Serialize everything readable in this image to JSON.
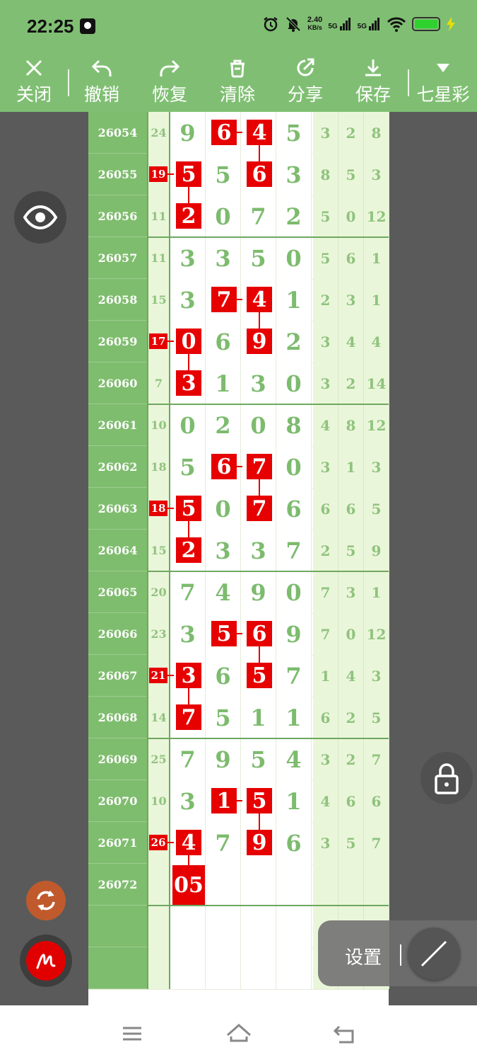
{
  "status_bar": {
    "time": "22:25",
    "speed_value": "2.40",
    "speed_unit": "KB/s",
    "signal1": "5G",
    "signal2": "5G"
  },
  "toolbar": {
    "close": "关闭",
    "undo": "撤销",
    "redo": "恢复",
    "clear": "清除",
    "share": "分享",
    "save": "保存",
    "lottery": "七星彩"
  },
  "chart_data": {
    "type": "table",
    "columns": [
      "issue",
      "sum",
      "d1",
      "d2",
      "d3",
      "d4",
      "s1",
      "s2",
      "s3"
    ],
    "rows": [
      {
        "issue": "26054",
        "sum": "24",
        "digits": [
          "9",
          "6",
          "4",
          "5"
        ],
        "side": [
          "3",
          "2",
          "8"
        ]
      },
      {
        "issue": "26055",
        "sum": "19",
        "digits": [
          "5",
          "5",
          "6",
          "3"
        ],
        "side": [
          "8",
          "5",
          "3"
        ]
      },
      {
        "issue": "26056",
        "sum": "11",
        "digits": [
          "2",
          "0",
          "7",
          "2"
        ],
        "side": [
          "5",
          "0",
          "12"
        ]
      },
      {
        "issue": "26057",
        "sum": "11",
        "digits": [
          "3",
          "3",
          "5",
          "0"
        ],
        "side": [
          "5",
          "6",
          "1"
        ]
      },
      {
        "issue": "26058",
        "sum": "15",
        "digits": [
          "3",
          "7",
          "4",
          "1"
        ],
        "side": [
          "2",
          "3",
          "1"
        ]
      },
      {
        "issue": "26059",
        "sum": "17",
        "digits": [
          "0",
          "6",
          "9",
          "2"
        ],
        "side": [
          "3",
          "4",
          "4"
        ]
      },
      {
        "issue": "26060",
        "sum": "7",
        "digits": [
          "3",
          "1",
          "3",
          "0"
        ],
        "side": [
          "3",
          "2",
          "14"
        ]
      },
      {
        "issue": "26061",
        "sum": "10",
        "digits": [
          "0",
          "2",
          "0",
          "8"
        ],
        "side": [
          "4",
          "8",
          "12"
        ]
      },
      {
        "issue": "26062",
        "sum": "18",
        "digits": [
          "5",
          "6",
          "7",
          "0"
        ],
        "side": [
          "3",
          "1",
          "3"
        ]
      },
      {
        "issue": "26063",
        "sum": "18",
        "digits": [
          "5",
          "0",
          "7",
          "6"
        ],
        "side": [
          "6",
          "6",
          "5"
        ]
      },
      {
        "issue": "26064",
        "sum": "15",
        "digits": [
          "2",
          "3",
          "3",
          "7"
        ],
        "side": [
          "2",
          "5",
          "9"
        ]
      },
      {
        "issue": "26065",
        "sum": "20",
        "digits": [
          "7",
          "4",
          "9",
          "0"
        ],
        "side": [
          "7",
          "3",
          "1"
        ]
      },
      {
        "issue": "26066",
        "sum": "23",
        "digits": [
          "3",
          "5",
          "6",
          "9"
        ],
        "side": [
          "7",
          "0",
          "12"
        ]
      },
      {
        "issue": "26067",
        "sum": "21",
        "digits": [
          "3",
          "6",
          "5",
          "7"
        ],
        "side": [
          "1",
          "4",
          "3"
        ]
      },
      {
        "issue": "26068",
        "sum": "14",
        "digits": [
          "7",
          "5",
          "1",
          "1"
        ],
        "side": [
          "6",
          "2",
          "5"
        ]
      },
      {
        "issue": "26069",
        "sum": "25",
        "digits": [
          "7",
          "9",
          "5",
          "4"
        ],
        "side": [
          "3",
          "2",
          "7"
        ]
      },
      {
        "issue": "26070",
        "sum": "10",
        "digits": [
          "3",
          "1",
          "5",
          "1"
        ],
        "side": [
          "4",
          "6",
          "6"
        ]
      },
      {
        "issue": "26071",
        "sum": "26",
        "digits": [
          "4",
          "7",
          "9",
          "6"
        ],
        "side": [
          "3",
          "5",
          "7"
        ]
      },
      {
        "issue": "26072",
        "sum": "",
        "digits": [
          "05",
          "",
          "",
          ""
        ],
        "side": [
          "",
          "",
          ""
        ]
      }
    ],
    "highlights": [
      {
        "row": 0,
        "col": 1
      },
      {
        "row": 0,
        "col": 2
      },
      {
        "row": 1,
        "col": 2
      },
      {
        "row": 1,
        "col": 0
      },
      {
        "row": 1,
        "col": "sum"
      },
      {
        "row": 2,
        "col": 0
      },
      {
        "row": 4,
        "col": 1
      },
      {
        "row": 4,
        "col": 2
      },
      {
        "row": 5,
        "col": 2
      },
      {
        "row": 5,
        "col": 0
      },
      {
        "row": 5,
        "col": "sum"
      },
      {
        "row": 6,
        "col": 0
      },
      {
        "row": 8,
        "col": 1
      },
      {
        "row": 8,
        "col": 2
      },
      {
        "row": 9,
        "col": 2
      },
      {
        "row": 9,
        "col": 0
      },
      {
        "row": 9,
        "col": "sum"
      },
      {
        "row": 10,
        "col": 0
      },
      {
        "row": 12,
        "col": 1
      },
      {
        "row": 12,
        "col": 2
      },
      {
        "row": 13,
        "col": 2
      },
      {
        "row": 13,
        "col": 0
      },
      {
        "row": 13,
        "col": "sum"
      },
      {
        "row": 14,
        "col": 0
      },
      {
        "row": 16,
        "col": 1
      },
      {
        "row": 16,
        "col": 2
      },
      {
        "row": 17,
        "col": 2
      },
      {
        "row": 17,
        "col": 0
      },
      {
        "row": 17,
        "col": "sum"
      },
      {
        "row": 18,
        "col": 0
      }
    ]
  },
  "settings": {
    "label": "设置"
  },
  "colors": {
    "accent_green": "#80bf73",
    "highlight_red": "#e60000"
  }
}
